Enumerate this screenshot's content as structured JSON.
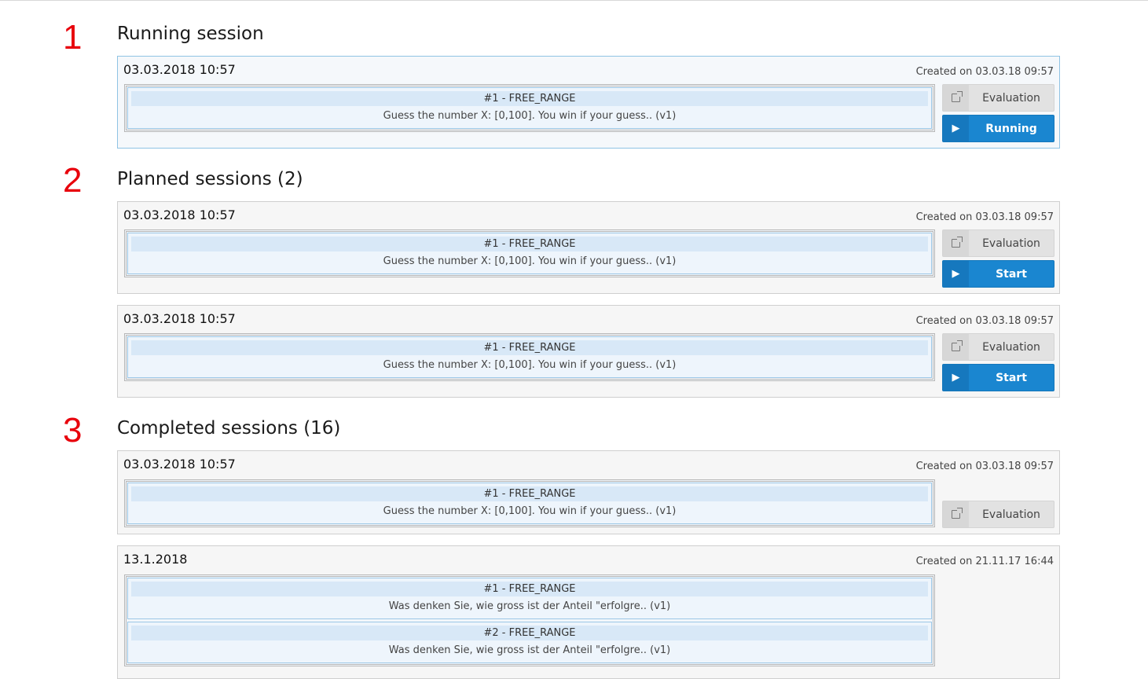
{
  "markers": [
    "1",
    "2",
    "3"
  ],
  "icons": {
    "external": "external-link-icon",
    "play": "play-icon"
  },
  "colors": {
    "marker": "#e8000b",
    "primary_button": "#1a86d0",
    "item_bg": "#d8e8f7"
  },
  "sections": {
    "running": {
      "title": "Running session",
      "sessions": [
        {
          "date": "03.03.2018 10:57",
          "created": "Created on 03.03.18 09:57",
          "items": [
            {
              "head": "#1 - FREE_RANGE",
              "desc": "Guess the number X: [0,100]. You win if your guess.. (v1)"
            }
          ],
          "eval_label": "Evaluation",
          "action_label": "Running"
        }
      ]
    },
    "planned": {
      "title": "Planned sessions (2)",
      "sessions": [
        {
          "date": "03.03.2018 10:57",
          "created": "Created on 03.03.18 09:57",
          "items": [
            {
              "head": "#1 - FREE_RANGE",
              "desc": "Guess the number X: [0,100]. You win if your guess.. (v1)"
            }
          ],
          "eval_label": "Evaluation",
          "action_label": "Start"
        },
        {
          "date": "03.03.2018 10:57",
          "created": "Created on 03.03.18 09:57",
          "items": [
            {
              "head": "#1 - FREE_RANGE",
              "desc": "Guess the number X: [0,100]. You win if your guess.. (v1)"
            }
          ],
          "eval_label": "Evaluation",
          "action_label": "Start"
        }
      ]
    },
    "completed": {
      "title": "Completed sessions (16)",
      "sessions": [
        {
          "date": "03.03.2018 10:57",
          "created": "Created on 03.03.18 09:57",
          "items": [
            {
              "head": "#1 - FREE_RANGE",
              "desc": "Guess the number X: [0,100]. You win if your guess.. (v1)"
            }
          ],
          "eval_label": "Evaluation"
        },
        {
          "date": "13.1.2018",
          "created": "Created on 21.11.17 16:44",
          "items": [
            {
              "head": "#1 - FREE_RANGE",
              "desc": "Was denken Sie, wie gross ist der Anteil \"erfolgre.. (v1)"
            },
            {
              "head": "#2 - FREE_RANGE",
              "desc": "Was denken Sie, wie gross ist der Anteil \"erfolgre.. (v1)"
            }
          ]
        }
      ]
    }
  }
}
